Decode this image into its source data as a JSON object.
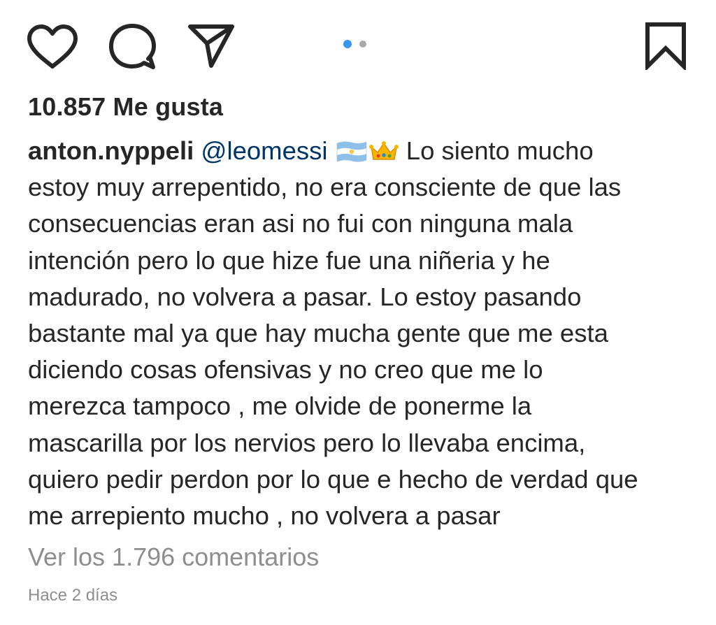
{
  "actions": {
    "like_icon": "heart-icon",
    "comment_icon": "comment-bubble-icon",
    "share_icon": "paper-plane-icon",
    "save_icon": "bookmark-icon"
  },
  "carousel": {
    "total": 2,
    "active_index": 1,
    "active_color": "#3897f0",
    "inactive_color": "#a8a8a8"
  },
  "post": {
    "likes": "10.857 Me gusta",
    "username": "anton.nyppeli",
    "mention": "@leomessi",
    "emoji_flag": "argentina-flag-emoji",
    "emoji_crown": "crown-emoji",
    "caption_lines": [
      "Lo siento mucho",
      "estoy muy arrepentido, no era consciente de que las",
      "consecuencias eran asi no fui con ninguna mala",
      "intención pero lo que hize fue una niñeria y he",
      "madurado, no volvera a pasar. Lo estoy pasando",
      "bastante mal ya que hay mucha gente que me esta",
      "diciendo cosas ofensivas y no creo que me lo",
      "merezca tampoco , me olvide de ponerme la",
      "mascarilla por los nervios pero lo llevaba encima,",
      "quiero pedir perdon por lo que e hecho de verdad que",
      "me arrepiento mucho , no volvera a pasar"
    ],
    "view_comments": "Ver los 1.796 comentarios",
    "timestamp": "Hace 2 días"
  },
  "colors": {
    "text": "#262626",
    "mention": "#003569",
    "secondary": "#8e8e8e"
  }
}
